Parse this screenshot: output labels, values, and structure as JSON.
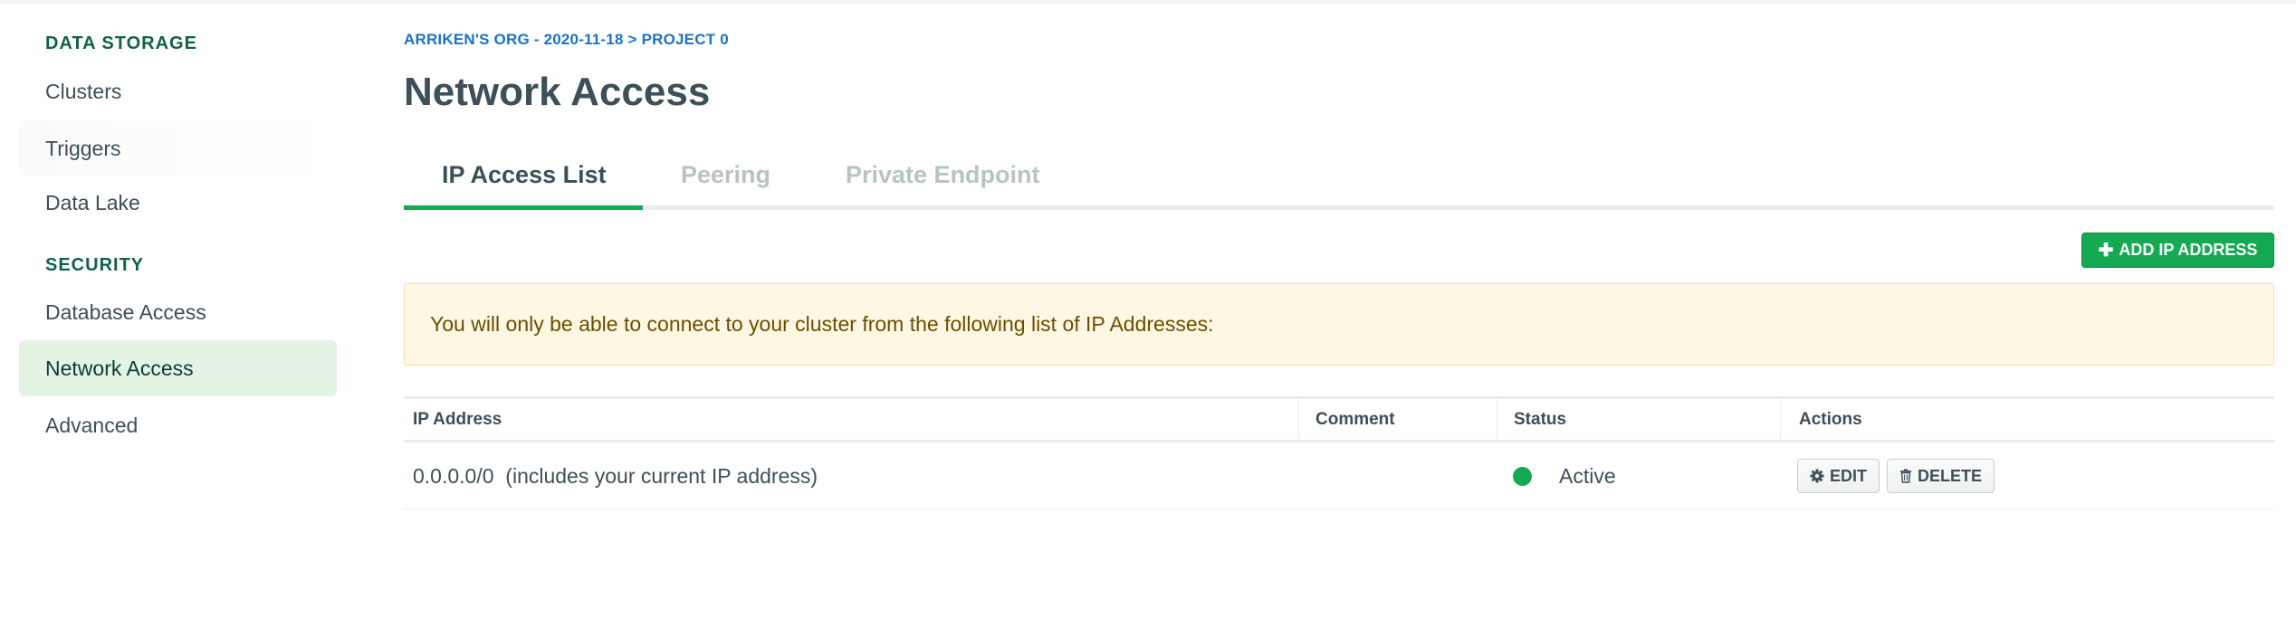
{
  "sidebar": {
    "sections": [
      {
        "title": "DATA STORAGE",
        "items": [
          "Clusters",
          "Triggers",
          "Data Lake"
        ]
      },
      {
        "title": "SECURITY",
        "items": [
          "Database Access",
          "Network Access",
          "Advanced"
        ]
      }
    ],
    "active_item": "Network Access"
  },
  "breadcrumb": "ARRIKEN'S ORG - 2020-11-18 > PROJECT 0",
  "page_title": "Network Access",
  "tabs": [
    {
      "label": "IP Access List",
      "active": true
    },
    {
      "label": "Peering",
      "active": false
    },
    {
      "label": "Private Endpoint",
      "active": false
    }
  ],
  "add_button": {
    "icon": "plus-icon",
    "label": "ADD IP ADDRESS"
  },
  "notice": "You will only be able to connect to your cluster from the following list of IP Addresses:",
  "table": {
    "columns": [
      "IP Address",
      "Comment",
      "Status",
      "Actions"
    ],
    "rows": [
      {
        "ip_address": "0.0.0.0/0  (includes your current IP address)",
        "comment": "",
        "status": "Active",
        "actions": [
          {
            "icon": "gear-icon",
            "label": "EDIT"
          },
          {
            "icon": "trash-icon",
            "label": "DELETE"
          }
        ]
      }
    ]
  },
  "colors": {
    "accent_green": "#13aa52",
    "section_title": "#116149",
    "breadcrumb_blue": "#1a73c4",
    "active_sidebar_bg": "#e4f4e4",
    "notice_bg": "#fef7e3"
  }
}
